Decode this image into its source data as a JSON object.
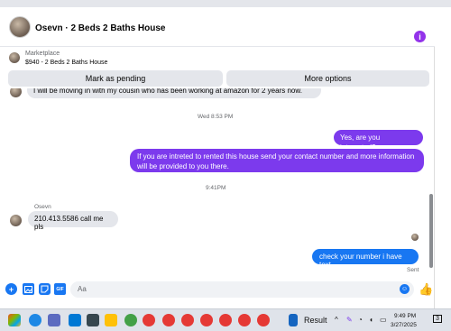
{
  "header": {
    "title": "Osevn · 2 Beds 2 Baths House"
  },
  "marketplace": {
    "label": "Marketplace",
    "item": "$940 - 2 Beds 2 Baths House"
  },
  "actions": {
    "pending_label": "Mark as pending",
    "more_label": "More options"
  },
  "messages": {
    "cut_message": "I will be moving in with my cousin who has been working at amazon for 2 years now.",
    "timestamp1": "Wed 8:53 PM",
    "out1": "Yes, are you interested?",
    "out2": "If you are intreted to rented this house send your contact number and more information will be provided to you there.",
    "timestamp2": "9:41PM",
    "sender_name": "Osevn",
    "in1": "210.413.5586 call me pls",
    "out3": "check your number i have text",
    "status": "Sent"
  },
  "composer": {
    "placeholder": "Aa",
    "gif_label": "GIF"
  },
  "taskbar": {
    "search_label": "Result",
    "time": "9:49 PM",
    "date": "3/27/2025",
    "notification_count": "3"
  },
  "colors": {
    "accent_purple": "#7c3aed",
    "messenger_blue": "#1877f2"
  }
}
